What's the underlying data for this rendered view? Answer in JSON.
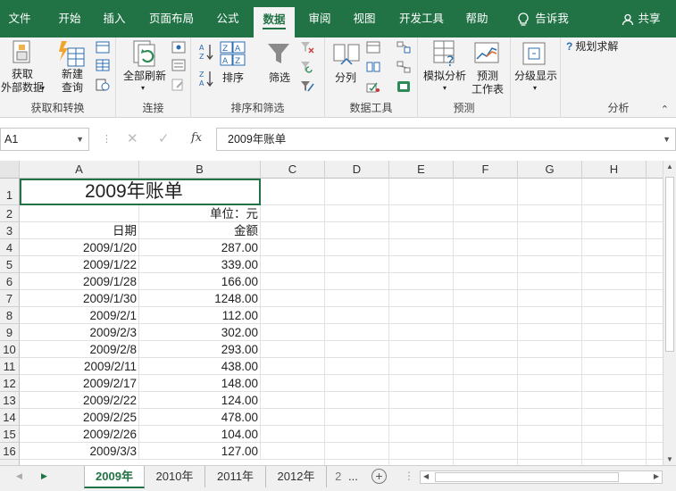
{
  "menu": {
    "items": [
      "文件",
      "开始",
      "插入",
      "页面布局",
      "公式",
      "数据",
      "审阅",
      "视图",
      "开发工具",
      "帮助"
    ],
    "active": "数据",
    "tellme": "告诉我",
    "share": "共享"
  },
  "ribbon": {
    "get_data_line1": "获取",
    "get_data_line2": "外部数据",
    "new_query_line1": "新建",
    "new_query_line2": "查询",
    "group_get_transform": "获取和转换",
    "refresh_all": "全部刷新",
    "group_connections": "连接",
    "sort": "排序",
    "filter": "筛选",
    "group_sort_filter": "排序和筛选",
    "text_to_columns": "分列",
    "group_data_tools": "数据工具",
    "what_if_line1": "模拟分析",
    "forecast_line1": "预测",
    "forecast_line2": "工作表",
    "group_forecast": "预测",
    "outline": "分级显示",
    "solver": "规划求解",
    "group_analysis": "分析",
    "sort_az_top": "A Z",
    "sort_za_top": "Z A"
  },
  "formula_bar": {
    "name_box": "A1",
    "fx_label": "fx",
    "formula": "2009年账单"
  },
  "columns": [
    "A",
    "B",
    "C",
    "D",
    "E",
    "F",
    "G",
    "H"
  ],
  "sheet": {
    "title": "2009年账单",
    "unit": "单位：元",
    "header_date": "日期",
    "header_amount": "金额",
    "rows": [
      {
        "row": "4",
        "date": "2009/1/20",
        "amount": "287.00"
      },
      {
        "row": "5",
        "date": "2009/1/22",
        "amount": "339.00"
      },
      {
        "row": "6",
        "date": "2009/1/28",
        "amount": "166.00"
      },
      {
        "row": "7",
        "date": "2009/1/30",
        "amount": "1248.00"
      },
      {
        "row": "8",
        "date": "2009/2/1",
        "amount": "112.00"
      },
      {
        "row": "9",
        "date": "2009/2/3",
        "amount": "302.00"
      },
      {
        "row": "10",
        "date": "2009/2/8",
        "amount": "293.00"
      },
      {
        "row": "11",
        "date": "2009/2/11",
        "amount": "438.00"
      },
      {
        "row": "12",
        "date": "2009/2/17",
        "amount": "148.00"
      },
      {
        "row": "13",
        "date": "2009/2/22",
        "amount": "124.00"
      },
      {
        "row": "14",
        "date": "2009/2/25",
        "amount": "478.00"
      },
      {
        "row": "15",
        "date": "2009/2/26",
        "amount": "104.00"
      },
      {
        "row": "16",
        "date": "2009/3/3",
        "amount": "127.00"
      }
    ]
  },
  "row_numbers_top": [
    "1",
    "2",
    "3"
  ],
  "tabs": {
    "items": [
      "2009年",
      "2010年",
      "2011年",
      "2012年"
    ],
    "active": "2009年",
    "more": "...",
    "truncated": "2"
  },
  "colors": {
    "accent": "#217346"
  }
}
